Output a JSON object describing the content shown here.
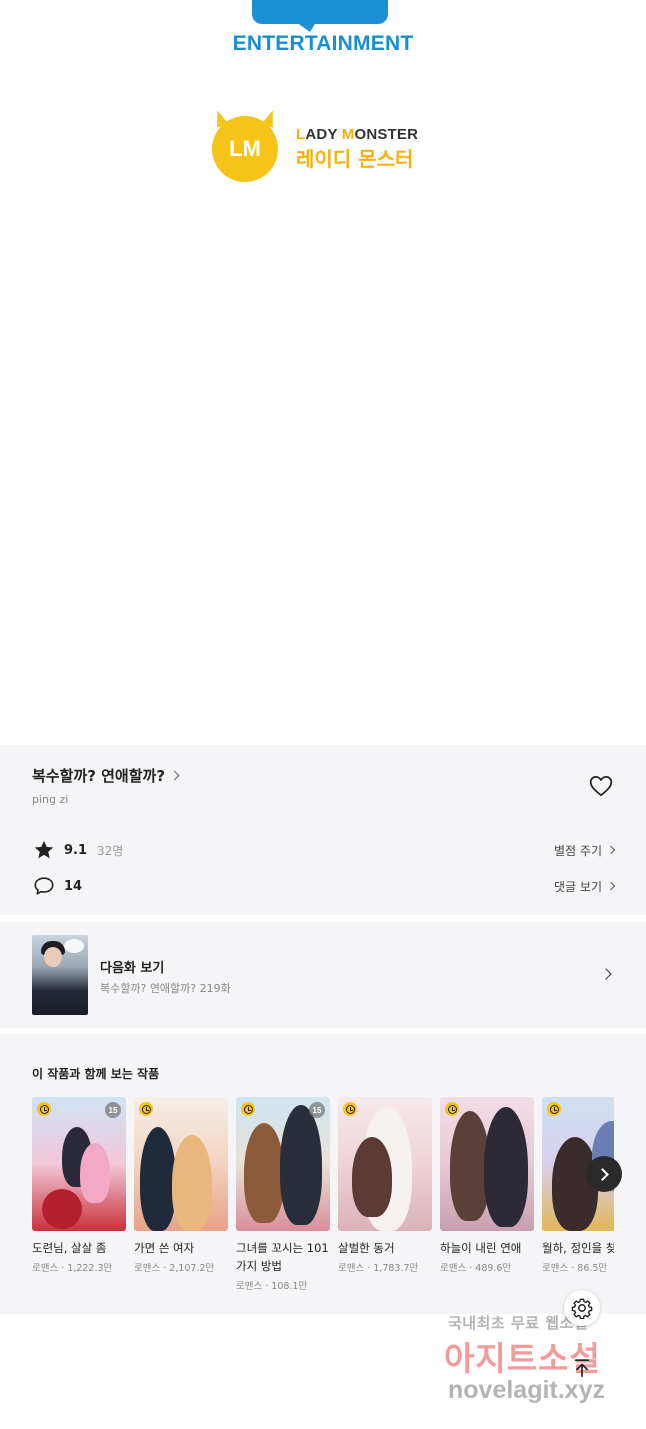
{
  "logos": {
    "entertainment_text": "ENTERTAINMENT",
    "lady_monster_mark": "LM",
    "lady_monster_en_prefix_1": "L",
    "lady_monster_en_1": "ADY ",
    "lady_monster_en_prefix_2": "M",
    "lady_monster_en_2": "ONSTER",
    "lady_monster_ko": "레이디 몬스터"
  },
  "work": {
    "title": "복수할까? 연애할까?",
    "author": "ping zi",
    "rating": "9.1",
    "rating_count": "32명",
    "rate_link": "별점 주기",
    "comment_count": "14",
    "comment_link": "댓글 보기"
  },
  "next_episode": {
    "label": "다음화 보기",
    "subtitle": "복수할까? 연애할까? 219화"
  },
  "recommendations": {
    "heading": "이 작품과 함께 보는 작품",
    "items": [
      {
        "title": "도련님, 살살 좀",
        "meta": "로맨스 · 1,222.3만",
        "age": "15"
      },
      {
        "title": "가면 쓴 여자",
        "meta": "로맨스 · 2,107.2만",
        "age": ""
      },
      {
        "title": "그녀를 꼬시는 101가지 방법",
        "meta": "로맨스 · 108.1만",
        "age": "15"
      },
      {
        "title": "살벌한 동거",
        "meta": "로맨스 · 1,783.7만",
        "age": ""
      },
      {
        "title": "하늘이 내린 연애",
        "meta": "로맨스 · 489.6만",
        "age": ""
      },
      {
        "title": "월하, 정인을 찾다",
        "meta": "로맨스 · 86.5만",
        "age": ""
      }
    ]
  },
  "watermark": {
    "line1": "국내최초 무료 웹소설",
    "line2": "아지트소설",
    "line3": "novelagit.xyz"
  },
  "icons": {
    "heart": "heart-icon",
    "star": "star-icon",
    "comment": "comment-icon",
    "settings": "gear-icon",
    "scroll_top": "arrow-up-to-top-icon"
  },
  "colors": {
    "brand_blue": "#1a8ed1",
    "brand_yellow": "#f6c419",
    "panel_bg": "#f5f5f7"
  }
}
